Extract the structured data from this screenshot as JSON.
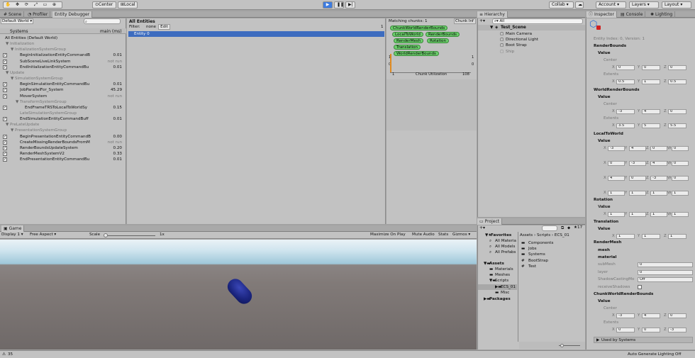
{
  "toolbar": {
    "center": "Center",
    "local": "Local",
    "collab": "Collab",
    "account": "Account",
    "layers": "Layers",
    "layout": "Layout",
    "tool_icons": [
      "hand-icon",
      "move-icon",
      "rotate-icon",
      "scale-icon",
      "rect-icon",
      "transform-icon"
    ]
  },
  "left_tabs": [
    "Scene",
    "Profiler",
    "Entity Debugger"
  ],
  "world_select": "Default World",
  "systems_header": {
    "label": "Systems",
    "col": "main (ms)"
  },
  "systems": [
    {
      "indent": 0,
      "check": false,
      "label": "All Entities (Default World)",
      "value": ""
    },
    {
      "indent": 1,
      "check": false,
      "arrow": "▼",
      "label": "Initialization",
      "value": "",
      "grey": true
    },
    {
      "indent": 2,
      "check": false,
      "arrow": "▼",
      "label": "InitializationSystemGroup",
      "value": "",
      "grey": true
    },
    {
      "indent": 3,
      "check": true,
      "label": "BeginInitializationEntityCommandB",
      "value": "0.01"
    },
    {
      "indent": 3,
      "check": true,
      "label": "SubSceneLiveLinkSystem",
      "value": "not run",
      "grey_val": true
    },
    {
      "indent": 3,
      "check": true,
      "label": "EndInitializationEntityCommandBu",
      "value": "0.01"
    },
    {
      "indent": 1,
      "check": false,
      "arrow": "▼",
      "label": "Update",
      "value": "",
      "grey": true
    },
    {
      "indent": 2,
      "check": false,
      "arrow": "▼",
      "label": "SimulationSystemGroup",
      "value": "",
      "grey": true
    },
    {
      "indent": 3,
      "check": true,
      "label": "BeginSimulationEntityCommandBu",
      "value": "0.01"
    },
    {
      "indent": 3,
      "check": true,
      "label": "JobParallelFor_System",
      "value": "45.29"
    },
    {
      "indent": 3,
      "check": true,
      "label": "MoverSystem",
      "value": "not run",
      "grey_val": true
    },
    {
      "indent": 3,
      "check": false,
      "arrow": "▼",
      "label": "TransformSystemGroup",
      "value": "",
      "grey": true
    },
    {
      "indent": 4,
      "check": true,
      "label": "EndFrameTRSToLocalToWorldSy",
      "value": "0.15"
    },
    {
      "indent": 3,
      "check": false,
      "label": "LateSimulationSystemGroup",
      "value": "",
      "grey": true
    },
    {
      "indent": 3,
      "check": true,
      "label": "EndSimulationEntityCommandBuff",
      "value": "0.01"
    },
    {
      "indent": 1,
      "check": false,
      "arrow": "▼",
      "label": "PreLateUpdate",
      "value": "",
      "grey": true
    },
    {
      "indent": 2,
      "check": false,
      "arrow": "▼",
      "label": "PresentationSystemGroup",
      "value": "",
      "grey": true
    },
    {
      "indent": 3,
      "check": true,
      "label": "BeginPresentationEntityCommandB",
      "value": "0.00"
    },
    {
      "indent": 3,
      "check": true,
      "label": "CreateMissingRenderBoundsFromM",
      "value": "not run",
      "grey_val": true
    },
    {
      "indent": 3,
      "check": true,
      "label": "RenderBoundsUpdateSystem",
      "value": "0.20"
    },
    {
      "indent": 3,
      "check": true,
      "label": "RenderMeshSystemV2",
      "value": "0.33"
    },
    {
      "indent": 3,
      "check": true,
      "label": "EndPresentationEntityCommandBu",
      "value": "0.01"
    }
  ],
  "entities": {
    "title": "All Entities",
    "filter_label": "Filter:",
    "filter_value": "none",
    "edit": "Edit",
    "count": "1",
    "items": [
      "Entity 0"
    ]
  },
  "chunks": {
    "title": "Matching chunks: 1",
    "chunk_info": "Chunk Inf",
    "chips": [
      "ChunkWorldRenderBounds",
      "LocalToWorld",
      "RenderBounds",
      "RenderMesh",
      "Rotation",
      "Translation",
      "WorldRenderBounds"
    ],
    "left_top": "1",
    "left_mid": "0",
    "right_top": "1",
    "right_mid": "0",
    "bottom_left": "1",
    "bottom_label": "Chunk Utilization",
    "bottom_right": "108"
  },
  "hierarchy": {
    "tab": "Hierarchy",
    "create": "Create",
    "search": "All",
    "scene": "Test_Scene",
    "items": [
      {
        "label": "Main Camera",
        "grey": false
      },
      {
        "label": "Directional Light",
        "grey": false
      },
      {
        "label": "Boot Strap",
        "grey": false
      },
      {
        "label": "Ship",
        "grey": true
      }
    ]
  },
  "project": {
    "tab": "Project",
    "count": "17",
    "favorites": "Favorites",
    "fav_items": [
      "All Materia",
      "All Models",
      "All Prefabs"
    ],
    "assets": "Assets",
    "asset_tree": [
      {
        "label": "Materials",
        "depth": 1
      },
      {
        "label": "Meshes",
        "depth": 1
      },
      {
        "label": "Scripts",
        "depth": 1,
        "arrow": "▼"
      },
      {
        "label": "ECS_01",
        "depth": 2,
        "arrow": "▶",
        "selected": true
      },
      {
        "label": "Misc",
        "depth": 2
      }
    ],
    "packages": "Packages",
    "breadcrumb": "Assets › Scripts › ECS_01",
    "files": [
      {
        "label": "Components",
        "type": "folder"
      },
      {
        "label": "Jobs",
        "type": "folder"
      },
      {
        "label": "Systems",
        "type": "folder"
      },
      {
        "label": "BootStrap",
        "type": "script"
      },
      {
        "label": "Test",
        "type": "script"
      }
    ]
  },
  "inspector": {
    "tabs": [
      "Inspector",
      "Console",
      "Lighting"
    ],
    "entity_index": "Entity Index: 0, Version: 1",
    "sections": [
      {
        "title": "RenderBounds",
        "sub": "Value",
        "groups": [
          {
            "label": "Center",
            "x": "0",
            "y": "0",
            "z": "0"
          },
          {
            "label": "Extents",
            "x": "0.5",
            "y": "1",
            "z": "0.5"
          }
        ]
      },
      {
        "title": "WorldRenderBounds",
        "sub": "Value",
        "groups": [
          {
            "label": "Center",
            "x": "-3",
            "y": "4",
            "z": "0"
          },
          {
            "label": "Extents",
            "x": "3.5",
            "y": "5",
            "z": "5.5"
          }
        ]
      },
      {
        "title": "LocalToWorld",
        "sub": "Value",
        "matrix": [
          [
            "-3",
            "4",
            "0",
            "0"
          ],
          [
            "0",
            "-3",
            "4",
            "0"
          ],
          [
            "4",
            "0",
            "-3",
            "0"
          ],
          [
            "1",
            "1",
            "1",
            "1"
          ]
        ]
      },
      {
        "title": "Rotation",
        "sub": "Value",
        "xyzw": [
          "1",
          "1",
          "1",
          "1"
        ]
      },
      {
        "title": "Translation",
        "sub": "Value",
        "xyz": [
          "1",
          "1",
          "1"
        ]
      }
    ],
    "render_mesh": {
      "title": "RenderMesh",
      "mesh": "mesh",
      "material": "material",
      "submesh_label": "subMesh",
      "submesh": "0",
      "layer_label": "layer",
      "layer": "0",
      "shadow_label": "ShadowCastingMo",
      "shadow": "Off",
      "receive_label": "receiveShadows"
    },
    "chunk_bounds": {
      "title": "ChunkWorldRenderBounds",
      "sub": "Value",
      "center": {
        "label": "Center",
        "x": "-3",
        "y": "4",
        "z": "0"
      },
      "extents": {
        "label": "Extents",
        "x": "0",
        "y": "0",
        "z": "-3"
      }
    },
    "used_by": "Used by Systems"
  },
  "game": {
    "tab": "Game",
    "display": "Display 1",
    "aspect": "Free Aspect",
    "scale_label": "Scale",
    "scale_value": "1x",
    "maximize": "Maximize On Play",
    "mute": "Mute Audio",
    "stats": "Stats",
    "gizmos": "Gizmos"
  },
  "statusbar": {
    "left": "35",
    "right": "Auto Generate Lighting Off"
  },
  "colors": {
    "accent": "#3d6cbf",
    "chip": "#6cce6c",
    "play": "#3e7ce0"
  }
}
